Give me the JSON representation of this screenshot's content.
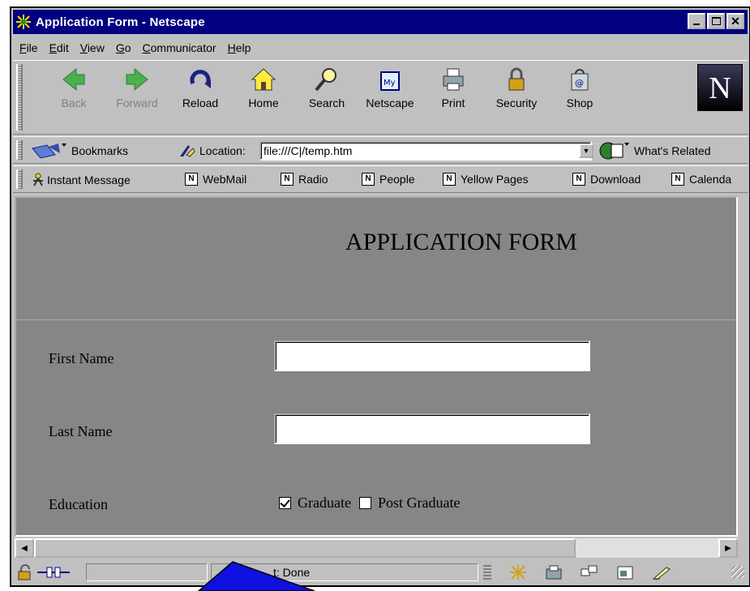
{
  "window": {
    "title": "Application Form - Netscape",
    "controls": [
      "minimize",
      "maximize",
      "close"
    ]
  },
  "menu": [
    {
      "label": "File",
      "key": "F",
      "rest": "ile"
    },
    {
      "label": "Edit",
      "key": "E",
      "rest": "dit"
    },
    {
      "label": "View",
      "key": "V",
      "rest": "iew"
    },
    {
      "label": "Go",
      "key": "G",
      "rest": "o"
    },
    {
      "label": "Communicator",
      "key": "C",
      "rest": "ommunicator"
    },
    {
      "label": "Help",
      "key": "H",
      "rest": "elp"
    }
  ],
  "toolbar": {
    "back": "Back",
    "forward": "Forward",
    "reload": "Reload",
    "home": "Home",
    "search": "Search",
    "netscape": "Netscape",
    "print": "Print",
    "security": "Security",
    "shop": "Shop",
    "logo": "N"
  },
  "location": {
    "bookmarks": "Bookmarks",
    "label": "Location:",
    "url": "file:///C|/temp.htm",
    "related": "What's Related"
  },
  "personal": {
    "items": [
      "Instant Message",
      "WebMail",
      "Radio",
      "People",
      "Yellow Pages",
      "Download",
      "Calenda"
    ]
  },
  "form": {
    "heading": "APPLICATION FORM",
    "first_name_label": "First Name",
    "first_name_value": "",
    "last_name_label": "Last Name",
    "last_name_value": "",
    "education_label": "Education",
    "graduate_label": "Graduate",
    "graduate_checked": true,
    "post_graduate_label": "Post Graduate",
    "post_graduate_checked": false
  },
  "status": {
    "text": "t: Done"
  },
  "colors": {
    "titlebar": "#000080",
    "chrome": "#c0c0c0",
    "content_bg": "#878587",
    "overlay_blue": "#1010e0"
  }
}
